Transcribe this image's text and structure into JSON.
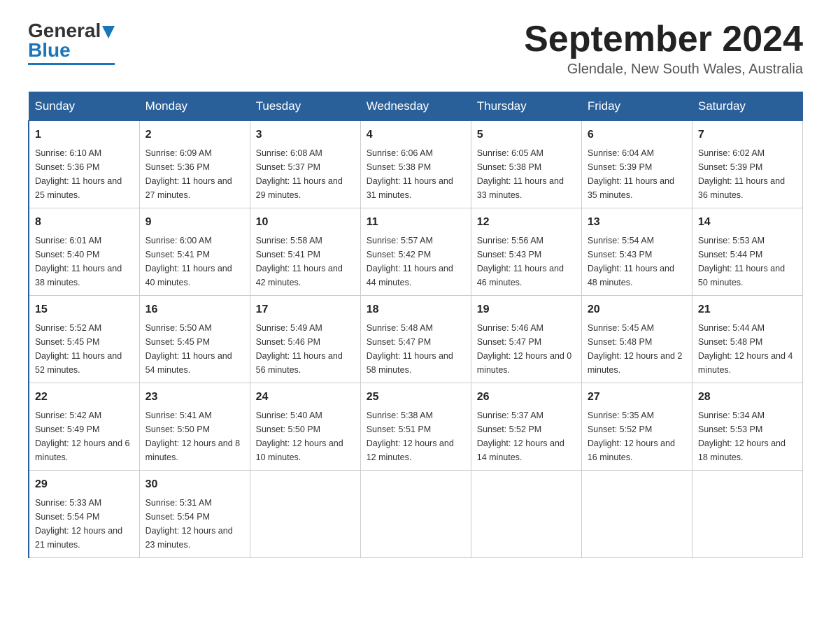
{
  "header": {
    "logo_text_black": "General",
    "logo_text_blue": "Blue",
    "month_title": "September 2024",
    "location": "Glendale, New South Wales, Australia"
  },
  "days_of_week": [
    "Sunday",
    "Monday",
    "Tuesday",
    "Wednesday",
    "Thursday",
    "Friday",
    "Saturday"
  ],
  "weeks": [
    [
      {
        "day": "1",
        "sunrise": "6:10 AM",
        "sunset": "5:36 PM",
        "daylight": "11 hours and 25 minutes."
      },
      {
        "day": "2",
        "sunrise": "6:09 AM",
        "sunset": "5:36 PM",
        "daylight": "11 hours and 27 minutes."
      },
      {
        "day": "3",
        "sunrise": "6:08 AM",
        "sunset": "5:37 PM",
        "daylight": "11 hours and 29 minutes."
      },
      {
        "day": "4",
        "sunrise": "6:06 AM",
        "sunset": "5:38 PM",
        "daylight": "11 hours and 31 minutes."
      },
      {
        "day": "5",
        "sunrise": "6:05 AM",
        "sunset": "5:38 PM",
        "daylight": "11 hours and 33 minutes."
      },
      {
        "day": "6",
        "sunrise": "6:04 AM",
        "sunset": "5:39 PM",
        "daylight": "11 hours and 35 minutes."
      },
      {
        "day": "7",
        "sunrise": "6:02 AM",
        "sunset": "5:39 PM",
        "daylight": "11 hours and 36 minutes."
      }
    ],
    [
      {
        "day": "8",
        "sunrise": "6:01 AM",
        "sunset": "5:40 PM",
        "daylight": "11 hours and 38 minutes."
      },
      {
        "day": "9",
        "sunrise": "6:00 AM",
        "sunset": "5:41 PM",
        "daylight": "11 hours and 40 minutes."
      },
      {
        "day": "10",
        "sunrise": "5:58 AM",
        "sunset": "5:41 PM",
        "daylight": "11 hours and 42 minutes."
      },
      {
        "day": "11",
        "sunrise": "5:57 AM",
        "sunset": "5:42 PM",
        "daylight": "11 hours and 44 minutes."
      },
      {
        "day": "12",
        "sunrise": "5:56 AM",
        "sunset": "5:43 PM",
        "daylight": "11 hours and 46 minutes."
      },
      {
        "day": "13",
        "sunrise": "5:54 AM",
        "sunset": "5:43 PM",
        "daylight": "11 hours and 48 minutes."
      },
      {
        "day": "14",
        "sunrise": "5:53 AM",
        "sunset": "5:44 PM",
        "daylight": "11 hours and 50 minutes."
      }
    ],
    [
      {
        "day": "15",
        "sunrise": "5:52 AM",
        "sunset": "5:45 PM",
        "daylight": "11 hours and 52 minutes."
      },
      {
        "day": "16",
        "sunrise": "5:50 AM",
        "sunset": "5:45 PM",
        "daylight": "11 hours and 54 minutes."
      },
      {
        "day": "17",
        "sunrise": "5:49 AM",
        "sunset": "5:46 PM",
        "daylight": "11 hours and 56 minutes."
      },
      {
        "day": "18",
        "sunrise": "5:48 AM",
        "sunset": "5:47 PM",
        "daylight": "11 hours and 58 minutes."
      },
      {
        "day": "19",
        "sunrise": "5:46 AM",
        "sunset": "5:47 PM",
        "daylight": "12 hours and 0 minutes."
      },
      {
        "day": "20",
        "sunrise": "5:45 AM",
        "sunset": "5:48 PM",
        "daylight": "12 hours and 2 minutes."
      },
      {
        "day": "21",
        "sunrise": "5:44 AM",
        "sunset": "5:48 PM",
        "daylight": "12 hours and 4 minutes."
      }
    ],
    [
      {
        "day": "22",
        "sunrise": "5:42 AM",
        "sunset": "5:49 PM",
        "daylight": "12 hours and 6 minutes."
      },
      {
        "day": "23",
        "sunrise": "5:41 AM",
        "sunset": "5:50 PM",
        "daylight": "12 hours and 8 minutes."
      },
      {
        "day": "24",
        "sunrise": "5:40 AM",
        "sunset": "5:50 PM",
        "daylight": "12 hours and 10 minutes."
      },
      {
        "day": "25",
        "sunrise": "5:38 AM",
        "sunset": "5:51 PM",
        "daylight": "12 hours and 12 minutes."
      },
      {
        "day": "26",
        "sunrise": "5:37 AM",
        "sunset": "5:52 PM",
        "daylight": "12 hours and 14 minutes."
      },
      {
        "day": "27",
        "sunrise": "5:35 AM",
        "sunset": "5:52 PM",
        "daylight": "12 hours and 16 minutes."
      },
      {
        "day": "28",
        "sunrise": "5:34 AM",
        "sunset": "5:53 PM",
        "daylight": "12 hours and 18 minutes."
      }
    ],
    [
      {
        "day": "29",
        "sunrise": "5:33 AM",
        "sunset": "5:54 PM",
        "daylight": "12 hours and 21 minutes."
      },
      {
        "day": "30",
        "sunrise": "5:31 AM",
        "sunset": "5:54 PM",
        "daylight": "12 hours and 23 minutes."
      },
      null,
      null,
      null,
      null,
      null
    ]
  ],
  "labels": {
    "sunrise": "Sunrise:",
    "sunset": "Sunset:",
    "daylight": "Daylight:"
  }
}
